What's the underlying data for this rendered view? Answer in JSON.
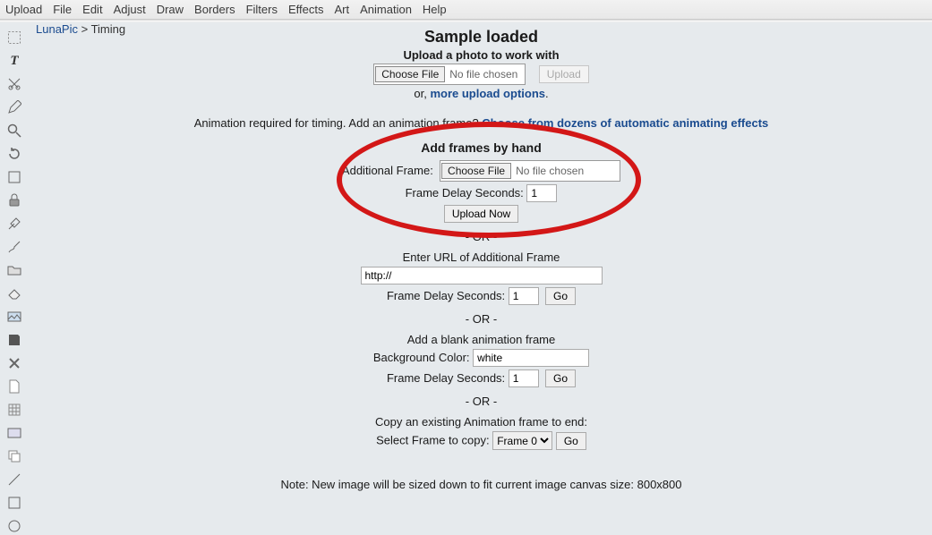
{
  "menu": {
    "items": [
      "Upload",
      "File",
      "Edit",
      "Adjust",
      "Draw",
      "Borders",
      "Filters",
      "Effects",
      "Art",
      "Animation",
      "Help"
    ]
  },
  "breadcrumb": {
    "site": "LunaPic",
    "sep": " > ",
    "page": "Timing"
  },
  "tools": [
    "select-rect",
    "text",
    "scissors",
    "pencil",
    "magnifier",
    "rotate",
    "crop-frame",
    "lock",
    "eyedropper",
    "brush",
    "folder",
    "eraser",
    "picture",
    "save",
    "close-x",
    "page",
    "hatch",
    "image",
    "copy",
    "line",
    "square",
    "circle"
  ],
  "sample": {
    "title": "Sample loaded",
    "subtitle": "Upload a photo to work with",
    "choose": "Choose File",
    "nofile": "No file chosen",
    "upload_btn": "Upload",
    "or": "or, ",
    "more": "more upload options",
    "period": "."
  },
  "anim_req": {
    "text": "Animation required for timing. Add an animation frame? ",
    "link": "Choose from dozens of automatic animating effects"
  },
  "byhand": {
    "heading": "Add frames by hand",
    "additional": "Additional Frame:",
    "choose": "Choose File",
    "nofile": "No file chosen",
    "delay_label": "Frame Delay Seconds:",
    "delay_value": "1",
    "upload_now": "Upload Now"
  },
  "or_sep": "- OR -",
  "url_sec": {
    "heading": "Enter URL of Additional Frame",
    "url_value": "http://",
    "delay_label": "Frame Delay Seconds:",
    "delay_value": "1",
    "go": "Go"
  },
  "blank_sec": {
    "heading": "Add a blank animation frame",
    "bg_label": "Background Color:",
    "bg_value": "white",
    "delay_label": "Frame Delay Seconds:",
    "delay_value": "1",
    "go": "Go"
  },
  "copy_sec": {
    "heading": "Copy an existing Animation frame to end:",
    "select_label": "Select Frame to copy:",
    "select_value": "Frame 0",
    "go": "Go"
  },
  "note": "Note: New image will be sized down to fit current image canvas size: 800x800"
}
